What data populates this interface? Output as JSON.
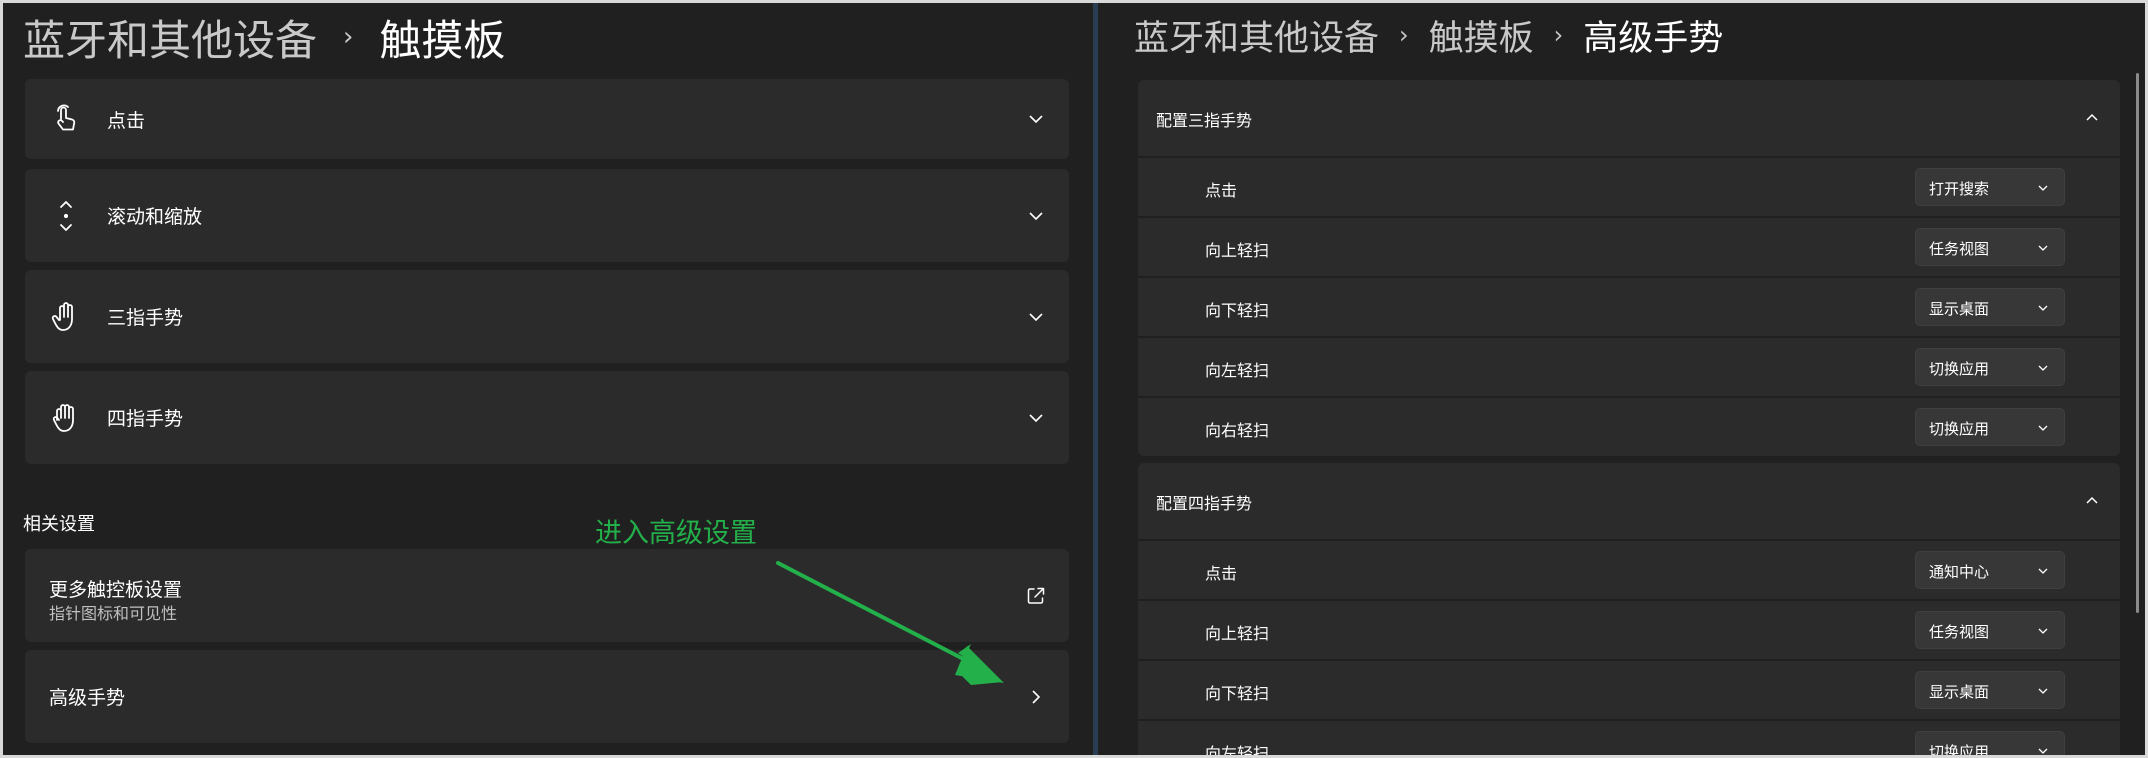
{
  "left": {
    "breadcrumb": [
      "蓝牙和其他设备",
      "触摸板"
    ],
    "cards": [
      {
        "label": "点击",
        "icon": "tap-icon"
      },
      {
        "label": "滚动和缩放",
        "icon": "scroll-icon"
      },
      {
        "label": "三指手势",
        "icon": "three-finger-hand-icon"
      },
      {
        "label": "四指手势",
        "icon": "four-finger-hand-icon"
      }
    ],
    "related_title": "相关设置",
    "more_settings": {
      "title": "更多触控板设置",
      "subtitle": "指针图标和可见性",
      "icon": "open-external-icon"
    },
    "advanced": {
      "label": "高级手势",
      "icon": "chevron-right-icon"
    },
    "annotation": "进入高级设置",
    "annotation_color": "#23b04a"
  },
  "right": {
    "breadcrumb": [
      "蓝牙和其他设备",
      "触摸板",
      "高级手势"
    ],
    "groups": [
      {
        "title": "配置三指手势",
        "rows": [
          {
            "label": "点击",
            "value": "打开搜索"
          },
          {
            "label": "向上轻扫",
            "value": "任务视图"
          },
          {
            "label": "向下轻扫",
            "value": "显示桌面"
          },
          {
            "label": "向左轻扫",
            "value": "切换应用"
          },
          {
            "label": "向右轻扫",
            "value": "切换应用"
          }
        ]
      },
      {
        "title": "配置四指手势",
        "rows": [
          {
            "label": "点击",
            "value": "通知中心"
          },
          {
            "label": "向上轻扫",
            "value": "任务视图"
          },
          {
            "label": "向下轻扫",
            "value": "显示桌面"
          },
          {
            "label": "向左轻扫",
            "value": "切换应用"
          }
        ]
      }
    ]
  },
  "colors": {
    "background": "#202020",
    "card": "#2b2b2b",
    "accent_annotation": "#23b04a"
  }
}
